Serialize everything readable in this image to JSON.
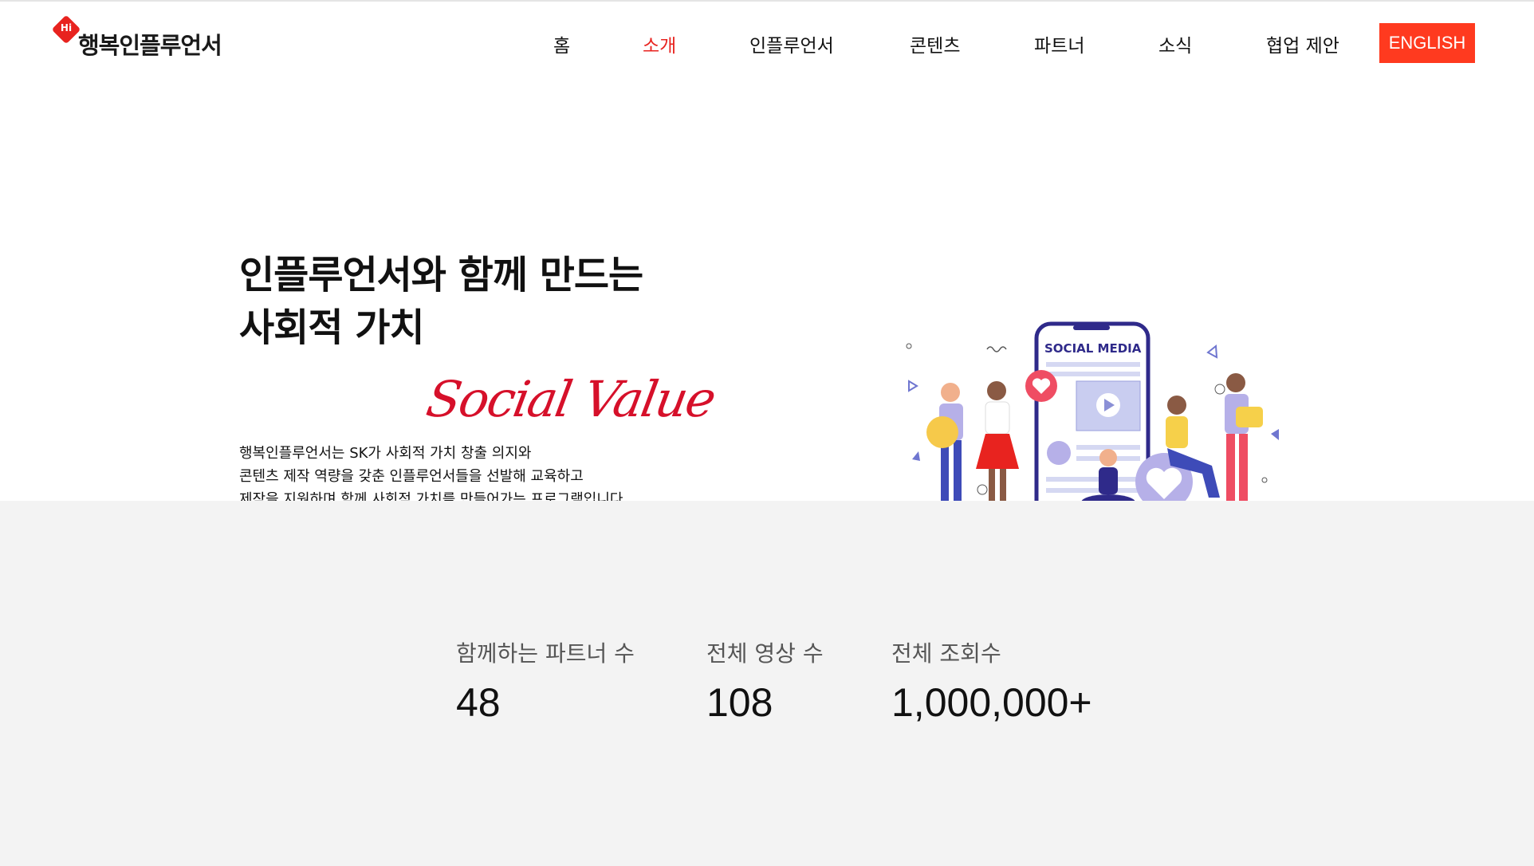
{
  "header": {
    "logo_badge": "Hi",
    "logo_text": "행복인플루언서",
    "nav": [
      {
        "label": "홈",
        "active": false
      },
      {
        "label": "소개",
        "active": true
      },
      {
        "label": "인플루언서",
        "active": false
      },
      {
        "label": "콘텐츠",
        "active": false
      },
      {
        "label": "파트너",
        "active": false
      },
      {
        "label": "소식",
        "active": false
      },
      {
        "label": "협업 제안",
        "active": false
      }
    ],
    "english_button": "ENGLISH"
  },
  "hero": {
    "headline_line1": "인플루언서와 함께 만드는",
    "headline_line2": "사회적 가치",
    "script_text": "Social Value",
    "description_line1": "행복인플루언서는 SK가 사회적 가치 창출 의지와",
    "description_line2": "콘텐츠 제작 역량을 갖춘 인플루언서들을 선발해 교육하고",
    "description_line3": "제작을 지원하며 함께 사회적 가치를 만들어가는 프로그램입니다.",
    "illustration_label": "SOCIAL MEDIA"
  },
  "stats": [
    {
      "label": "함께하는 파트너 수",
      "value": "48"
    },
    {
      "label": "전체 영상 수",
      "value": "108"
    },
    {
      "label": "전체 조회수",
      "value": "1,000,000+"
    }
  ],
  "colors": {
    "accent_red": "#e8231f",
    "english_bg": "#ff3a1f",
    "script_red": "#d6102a",
    "stats_bg": "#f3f3f3",
    "illustration_purple": "#2f2a8a"
  }
}
